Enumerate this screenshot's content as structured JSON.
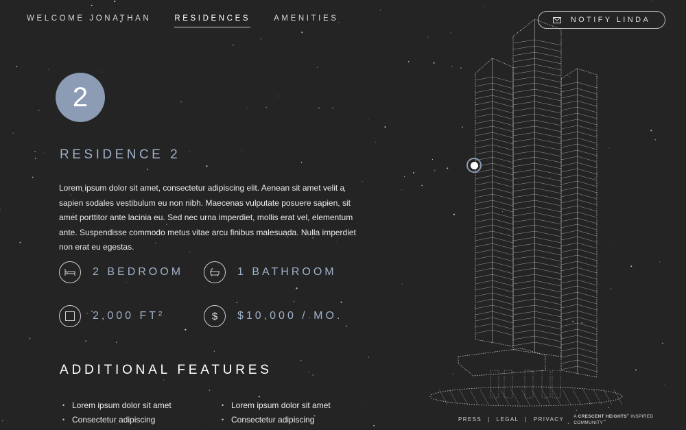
{
  "nav": {
    "items": [
      {
        "label": "WELCOME JONATHAN"
      },
      {
        "label": "RESIDENCES"
      },
      {
        "label": "AMENITIES"
      }
    ],
    "notify_label": "NOTIFY LINDA"
  },
  "residence": {
    "number": "2",
    "title": "RESIDENCE 2",
    "description": "Lorem ipsum dolor sit amet, consectetur adipiscing elit. Aenean sit amet velit a sapien sodales vestibulum eu non nibh. Maecenas vulputate posuere sapien, sit amet porttitor ante lacinia eu. Sed nec urna imperdiet, mollis erat vel, elementum ante. Suspendisse commodo metus vitae arcu finibus malesuada. Nulla imperdiet non erat eu egestas.",
    "stats": {
      "bedroom": "2 BEDROOM",
      "bathroom": "1 BATHROOM",
      "area": "2,000 FT²",
      "price": "$10,000 / MO."
    }
  },
  "features": {
    "title": "ADDITIONAL FEATURES",
    "col1": [
      "Lorem ipsum dolor sit amet",
      "Consectetur adipiscing"
    ],
    "col2": [
      "Lorem ipsum dolor sit amet",
      "Consectetur adipiscing"
    ]
  },
  "footer": {
    "press": "PRESS",
    "legal": "LEGAL",
    "privacy": "PRIVACY",
    "brand_prefix": "A",
    "brand_name": "CRESCENT HEIGHTS",
    "brand_suffix": "INSPIRED COMMUNITY"
  },
  "colors": {
    "background": "#242424",
    "accent": "#8c9cb4",
    "accent_text": "#9fb0c8"
  }
}
